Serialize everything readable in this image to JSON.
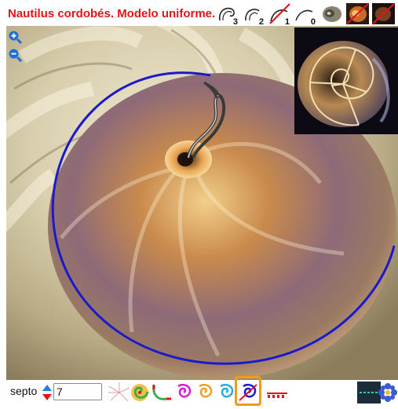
{
  "header": {
    "title": "Nautilus cordobés. Modelo uniforme.",
    "tools": [
      {
        "name": "draw-3-icon",
        "label": "3"
      },
      {
        "name": "draw-2-icon",
        "label": "2"
      },
      {
        "name": "draw-1-icon",
        "label": "1"
      },
      {
        "name": "draw-0-icon",
        "label": "0"
      },
      {
        "name": "shell-photo-icon",
        "label": ""
      },
      {
        "name": "hide-shell-icon",
        "label": ""
      },
      {
        "name": "hide-photo-icon",
        "label": ""
      }
    ]
  },
  "zoom": {
    "in_icon": "zoom-in-icon",
    "out_icon": "zoom-out-icon"
  },
  "controls": {
    "septo_label": "septo",
    "septo_value": "7"
  },
  "bottom_tools": [
    "radial-lines-icon",
    "colored-spiral-icon",
    "green-red-curve-icon",
    "magenta-spiral-icon",
    "orange-spiral-icon",
    "cyan-spiral-icon",
    "blue-red-spiral-icon",
    "red-dashed-line-icon",
    "green-dashed-line-icon",
    "blue-flower-icon"
  ],
  "colors": {
    "title": "#e0141a",
    "spiral": "#1a1acc",
    "selection": "#f39a16",
    "zoom": "#1e6fd6"
  }
}
